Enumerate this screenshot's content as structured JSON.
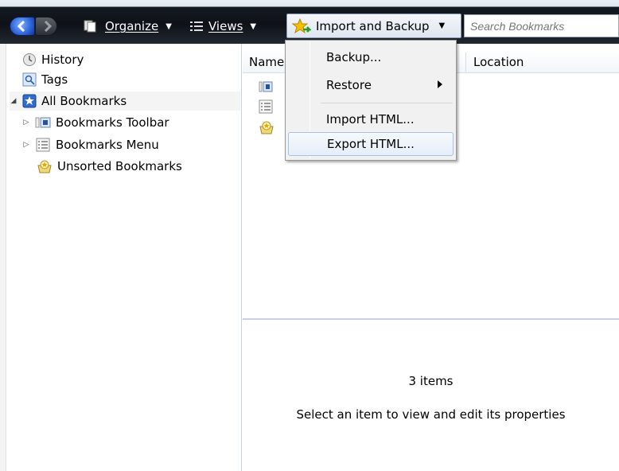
{
  "toolbar": {
    "organize_label": "Organize",
    "views_label": "Views",
    "import_backup_label": "Import and Backup",
    "search_placeholder": "Search Bookmarks"
  },
  "tree": {
    "items": [
      {
        "label": "History",
        "icon": "clock-icon"
      },
      {
        "label": "Tags",
        "icon": "tag-icon"
      },
      {
        "label": "All Bookmarks",
        "icon": "star-book-icon"
      },
      {
        "label": "Bookmarks Toolbar",
        "icon": "toolbar-icon"
      },
      {
        "label": "Bookmarks Menu",
        "icon": "menu-list-icon"
      },
      {
        "label": "Unsorted Bookmarks",
        "icon": "bookmark-folder-icon"
      }
    ]
  },
  "list": {
    "columns": [
      "Name",
      "Location"
    ]
  },
  "menu": {
    "items": [
      {
        "label": "Backup..."
      },
      {
        "label": "Restore",
        "has_submenu": true
      },
      {
        "label": "Import HTML..."
      },
      {
        "label": "Export HTML...",
        "highlighted": true
      }
    ]
  },
  "details": {
    "count": "3 items",
    "hint": "Select an item to view and edit its properties"
  },
  "colors": {
    "toolbar_dark": "#0e1117",
    "menu_highlight": "#e5eef9",
    "back_button": "#2d63d8"
  }
}
